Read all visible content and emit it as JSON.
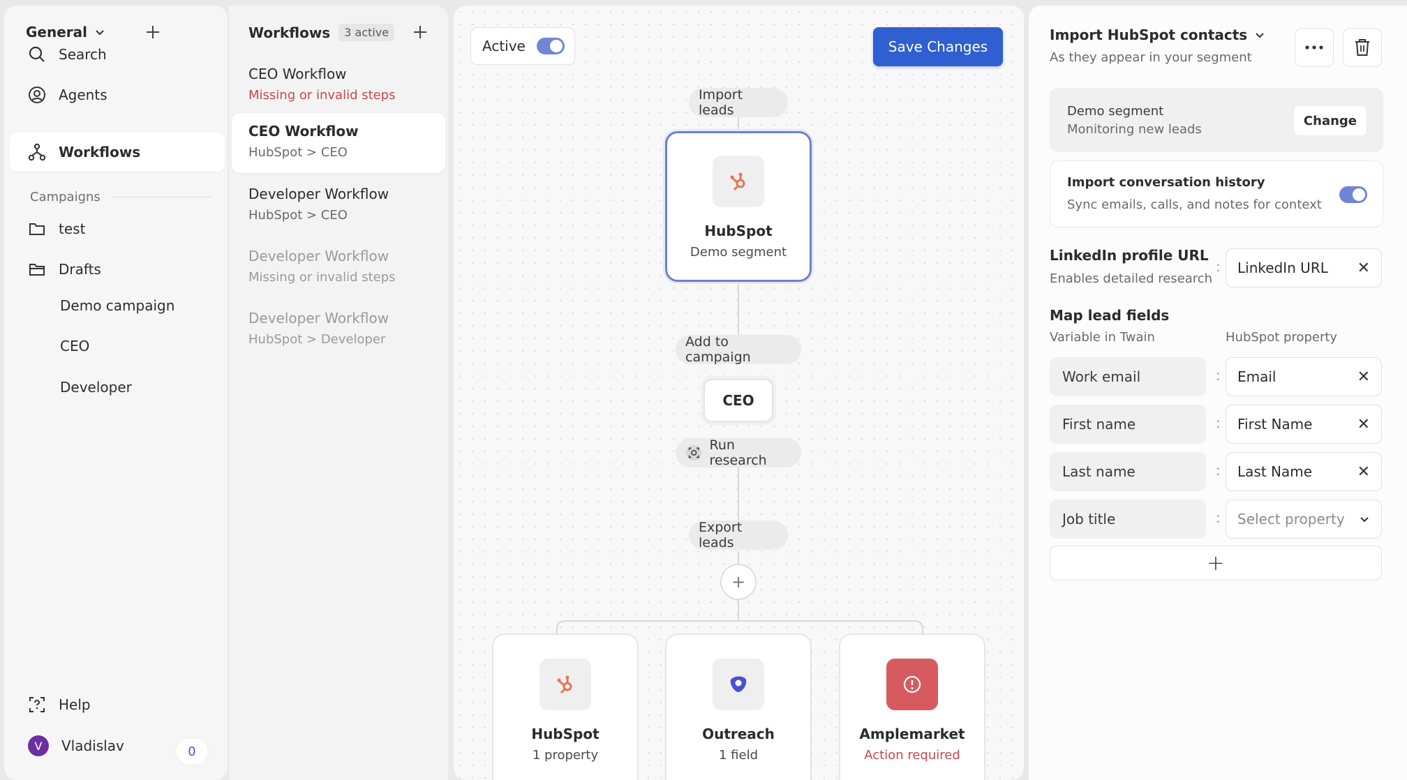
{
  "nav": {
    "workspace": "General",
    "items": [
      {
        "label": "Search",
        "icon": "search-icon"
      },
      {
        "label": "Agents",
        "icon": "agents-icon"
      },
      {
        "label": "Workflows",
        "icon": "workflows-icon"
      }
    ],
    "campaigns_label": "Campaigns",
    "campaigns": [
      {
        "label": "test",
        "icon": "folder-icon"
      },
      {
        "label": "Drafts",
        "icon": "folder-open-icon"
      }
    ],
    "drafts": [
      "Demo campaign",
      "CEO",
      "Developer"
    ],
    "help_label": "Help",
    "user": {
      "name": "Vladislav",
      "initial": "V",
      "count": "0"
    }
  },
  "workflows": {
    "title": "Workflows",
    "badge": "3 active",
    "items": [
      {
        "title": "CEO Workflow",
        "sub": "Missing or invalid steps"
      },
      {
        "title": "CEO Workflow",
        "sub": "HubSpot > CEO"
      },
      {
        "title": "Developer Workflow",
        "sub": "HubSpot > CEO"
      },
      {
        "title": "Developer Workflow",
        "sub": "Missing or invalid steps"
      },
      {
        "title": "Developer Workflow",
        "sub": "HubSpot > Developer"
      }
    ]
  },
  "canvas": {
    "active_label": "Active",
    "save_label": "Save Changes",
    "import_leads": "Import leads",
    "source_node": {
      "title": "HubSpot",
      "sub": "Demo segment"
    },
    "add_to_campaign": "Add to campaign",
    "campaign_node": "CEO",
    "run_research": "Run research",
    "export_leads": "Export leads",
    "add_symbol": "+",
    "exports": [
      {
        "title": "HubSpot",
        "sub": "1 property"
      },
      {
        "title": "Outreach",
        "sub": "1 field"
      },
      {
        "title": "Amplemarket",
        "sub": "Action required"
      }
    ]
  },
  "props": {
    "title": "Import HubSpot contacts",
    "subtitle": "As they appear in your segment",
    "segment": {
      "title": "Demo segment",
      "sub": "Monitoring new leads",
      "change_label": "Change"
    },
    "history": {
      "title": "Import conversation history",
      "sub": "Sync emails, calls, and notes for context"
    },
    "linkedin": {
      "label": "LinkedIn profile URL",
      "sub": "Enables detailed research",
      "value": "LinkedIn URL"
    },
    "map": {
      "title": "Map lead fields",
      "left_header": "Variable in Twain",
      "right_header": "HubSpot property",
      "rows": [
        {
          "variable": "Work email",
          "property": "Email"
        },
        {
          "variable": "First name",
          "property": "First Name"
        },
        {
          "variable": "Last name",
          "property": "Last Name"
        },
        {
          "variable": "Job title",
          "property": "Select property"
        }
      ]
    },
    "add_symbol": "+"
  },
  "colors": {
    "accent": "#2f5fd0",
    "error": "#c8474f",
    "hubspot": "#e8734e",
    "outreach": "#4b4fd6"
  }
}
